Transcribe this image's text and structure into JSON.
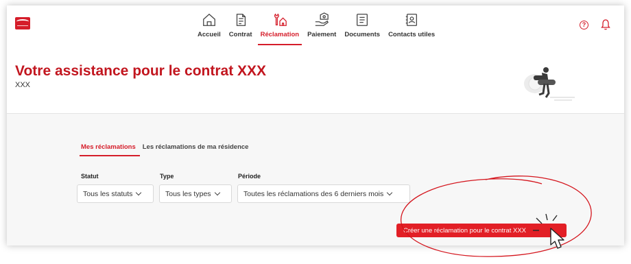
{
  "nav": {
    "items": [
      {
        "label": "Accueil",
        "icon": "home-icon",
        "active": false
      },
      {
        "label": "Contrat",
        "icon": "contract-icon",
        "active": false
      },
      {
        "label": "Réclamation",
        "icon": "wrench-house-icon",
        "active": true
      },
      {
        "label": "Paiement",
        "icon": "payment-icon",
        "active": false
      },
      {
        "label": "Documents",
        "icon": "document-icon",
        "active": false
      },
      {
        "label": "Contacts utiles",
        "icon": "contacts-icon",
        "active": false
      }
    ],
    "help_glyph": "?"
  },
  "header": {
    "title": "Votre assistance pour le contrat XXX",
    "subtitle": "XXX"
  },
  "tabs": [
    {
      "label": "Mes réclamations",
      "active": true
    },
    {
      "label": "Les réclamations de ma résidence",
      "active": false
    }
  ],
  "filters": {
    "statut": {
      "label": "Statut",
      "value": "Tous les statuts"
    },
    "type": {
      "label": "Type",
      "value": "Tous les types"
    },
    "periode": {
      "label": "Période",
      "value": "Toutes les réclamations des 6 derniers mois"
    }
  },
  "create_button": {
    "label": "Créer une réclamation pour le contrat  XXX"
  },
  "colors": {
    "accent": "#d51d2a",
    "button": "#e21f26",
    "annotation": "#d4141c"
  }
}
